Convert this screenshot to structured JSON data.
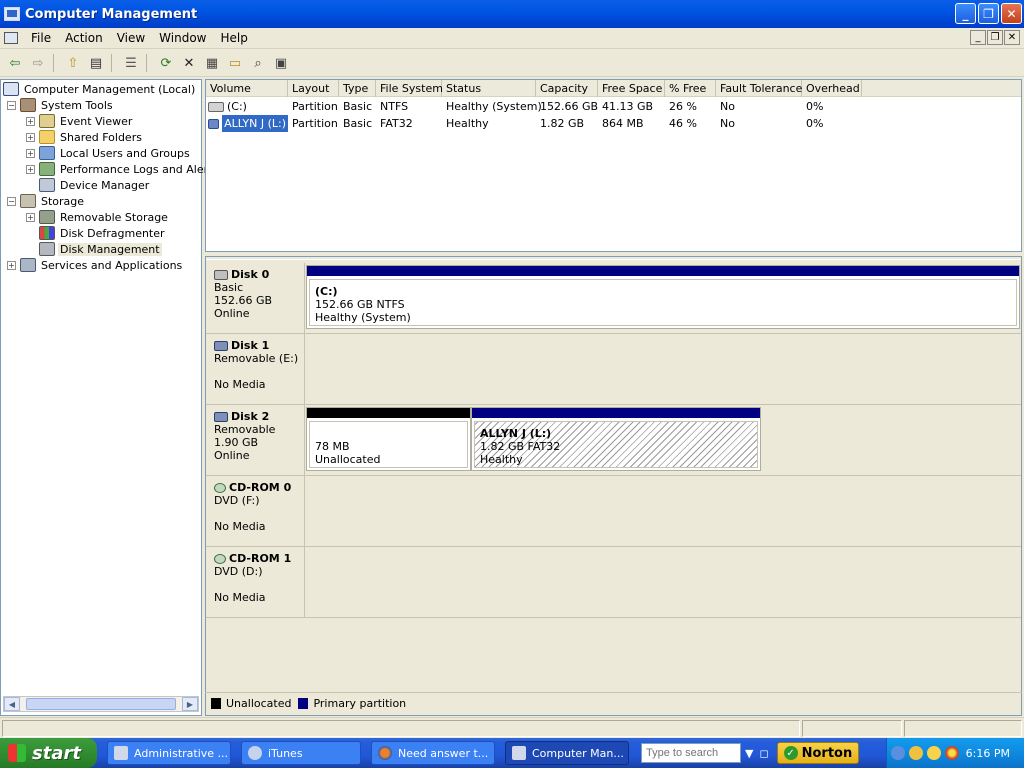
{
  "window": {
    "title": "Computer Management"
  },
  "menu": [
    "File",
    "Action",
    "View",
    "Window",
    "Help"
  ],
  "toolbar": {
    "buttons": [
      "back-arrow-icon",
      "forward-arrow-icon",
      "up-folder-icon",
      "show-hide-tree-icon",
      "properties-icon",
      "refresh-icon",
      "delete-icon",
      "properties-sheet-icon",
      "open-folder-icon",
      "search-icon",
      "help-icon"
    ]
  },
  "tree": {
    "root": "Computer Management (Local)",
    "system_tools": "System Tools",
    "event_viewer": "Event Viewer",
    "shared_folders": "Shared Folders",
    "local_users": "Local Users and Groups",
    "perf_logs": "Performance Logs and Alerts",
    "device_manager": "Device Manager",
    "storage": "Storage",
    "removable_storage": "Removable Storage",
    "disk_defragmenter": "Disk Defragmenter",
    "disk_management": "Disk Management",
    "services": "Services and Applications"
  },
  "volumes": {
    "columns": [
      "Volume",
      "Layout",
      "Type",
      "File System",
      "Status",
      "Capacity",
      "Free Space",
      "% Free",
      "Fault Tolerance",
      "Overhead"
    ],
    "rows": [
      [
        "(C:)",
        "Partition",
        "Basic",
        "NTFS",
        "Healthy (System)",
        "152.66 GB",
        "41.13 GB",
        "26 %",
        "No",
        "0%"
      ],
      [
        "ALLYN J (L:)",
        "Partition",
        "Basic",
        "FAT32",
        "Healthy",
        "1.82 GB",
        "864 MB",
        "46 %",
        "No",
        "0%"
      ]
    ]
  },
  "disks": {
    "disk0": {
      "name": "Disk 0",
      "type": "Basic",
      "size": "152.66 GB",
      "state": "Online",
      "part_name": "(C:)",
      "part_size": "152.66 GB NTFS",
      "part_status": "Healthy (System)"
    },
    "disk1": {
      "name": "Disk 1",
      "type": "Removable (E:)",
      "state": "No Media"
    },
    "disk2": {
      "name": "Disk 2",
      "type": "Removable",
      "size": "1.90 GB",
      "state": "Online",
      "unalloc_size": "78 MB",
      "unalloc_label": "Unallocated",
      "part_name": "ALLYN J  (L:)",
      "part_size": "1.82 GB FAT32",
      "part_status": "Healthy"
    },
    "cd0": {
      "name": "CD-ROM 0",
      "type": "DVD (F:)",
      "state": "No Media"
    },
    "cd1": {
      "name": "CD-ROM 1",
      "type": "DVD (D:)",
      "state": "No Media"
    }
  },
  "legend": {
    "unallocated": "Unallocated",
    "primary": "Primary partition"
  },
  "colors": {
    "primary_partition": "#000080",
    "unallocated": "#000000",
    "title_bar": "#0054e3",
    "selection": "#316ac5"
  },
  "taskbar": {
    "start": "start",
    "tasks": [
      "Administrative ...",
      "iTunes",
      "Need answer t...",
      "Computer Man..."
    ],
    "search_placeholder": "Type to search",
    "norton": "Norton",
    "clock": "6:16 PM"
  }
}
